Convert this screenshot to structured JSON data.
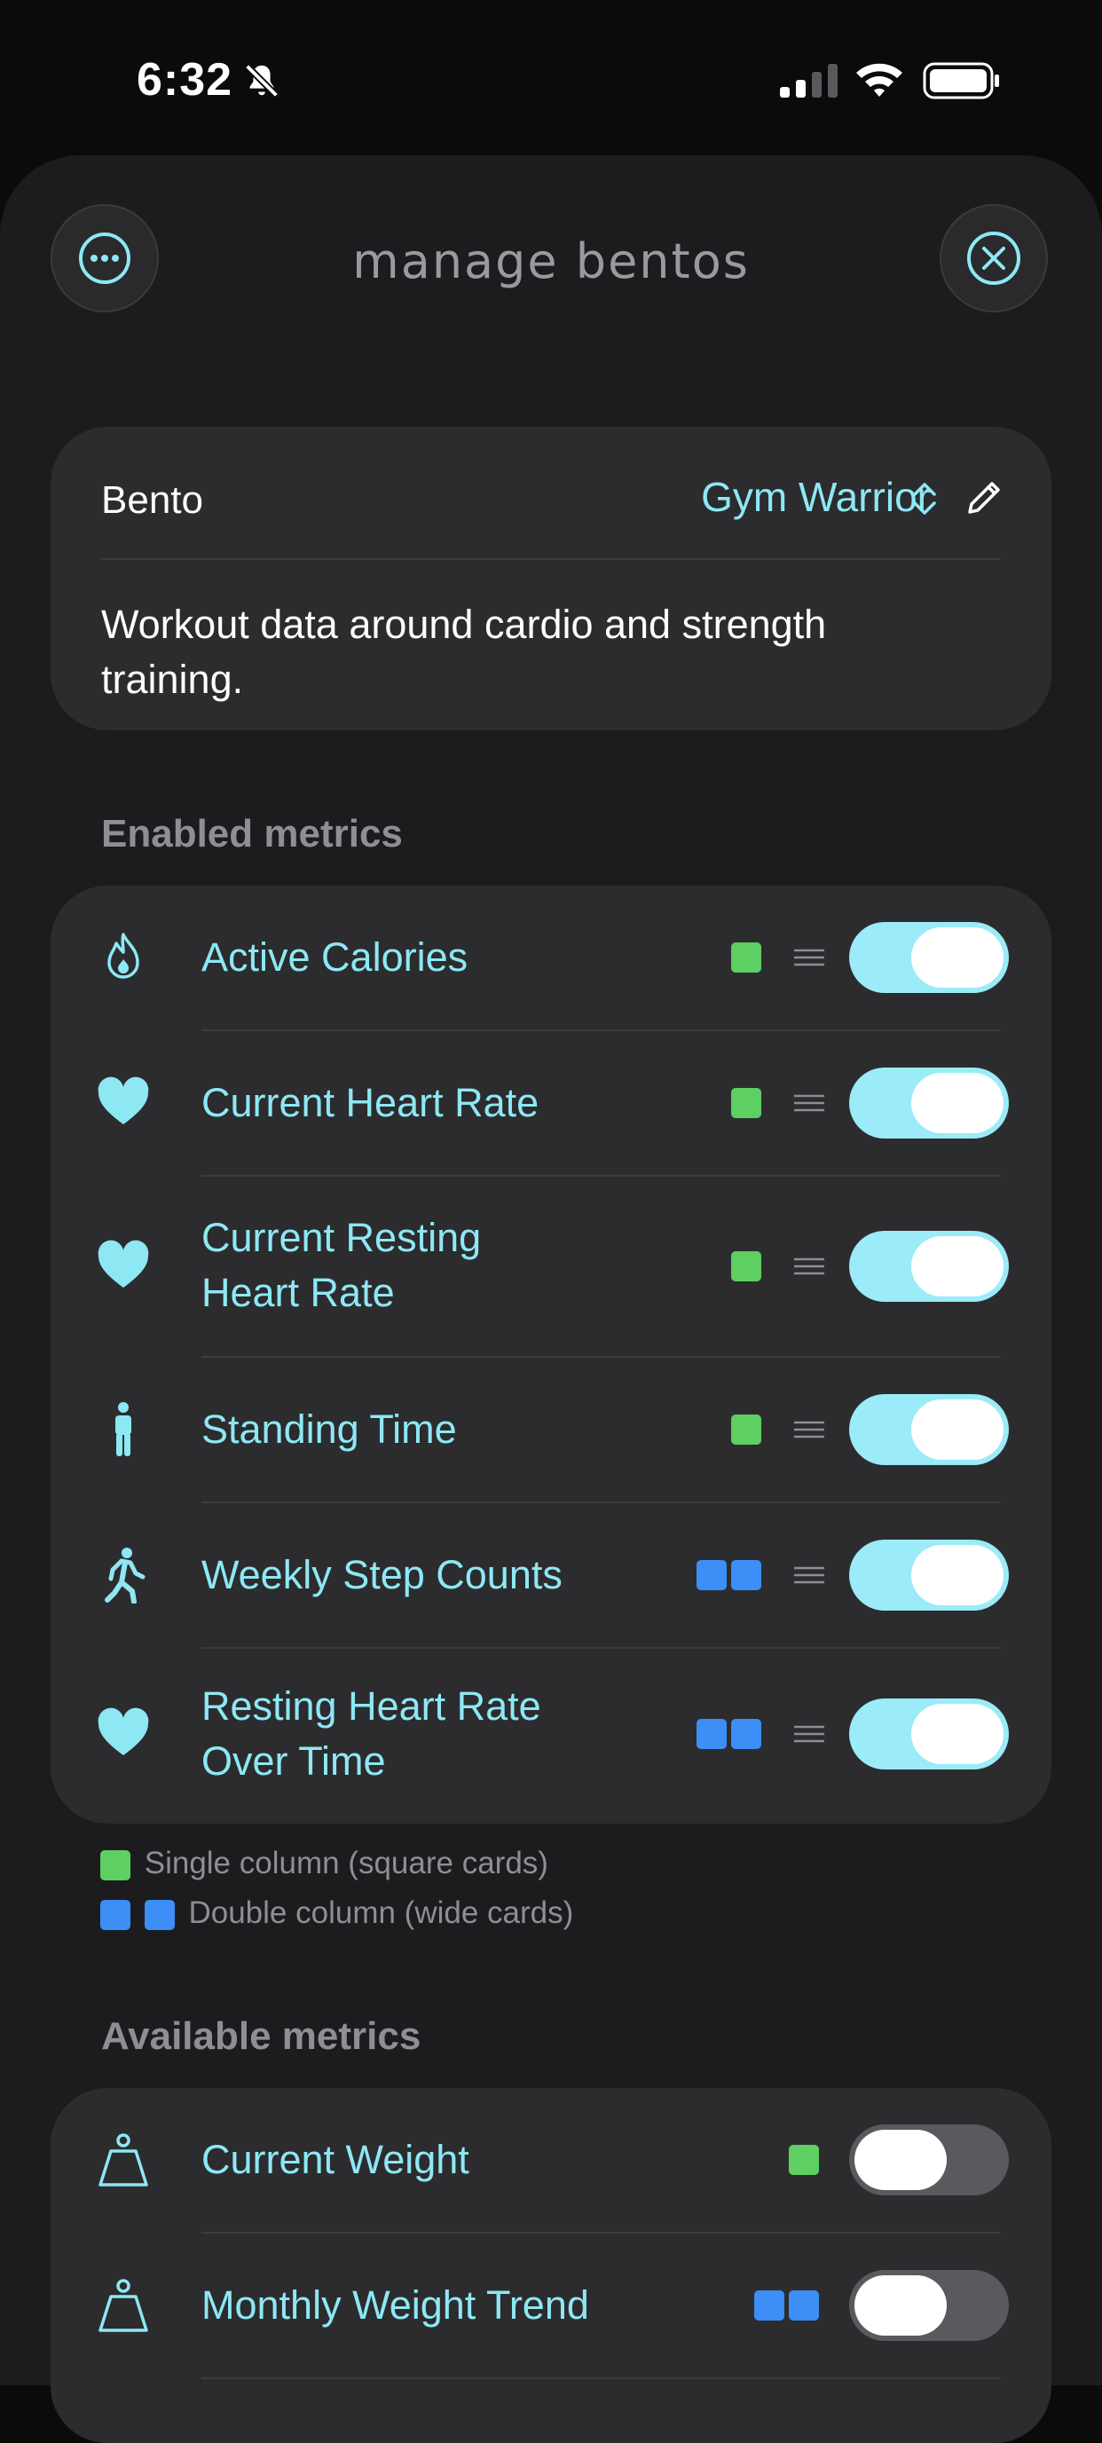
{
  "status": {
    "time": "6:32"
  },
  "sheet": {
    "title": "manage bentos"
  },
  "bento": {
    "label": "Bento",
    "value": "Gym Warrior",
    "description": "Workout data around cardio and strength training."
  },
  "enabled": {
    "header": "Enabled metrics",
    "items": [
      {
        "label": "Active Calories",
        "icon": "flame-icon",
        "size": "single",
        "enabled": true
      },
      {
        "label": "Current Heart Rate",
        "icon": "heart-icon",
        "size": "single",
        "enabled": true
      },
      {
        "label": "Current Resting Heart Rate",
        "icon": "heart-icon",
        "size": "single",
        "enabled": true
      },
      {
        "label": "Standing Time",
        "icon": "standing-person-icon",
        "size": "single",
        "enabled": true
      },
      {
        "label": "Weekly Step Counts",
        "icon": "walking-person-icon",
        "size": "double",
        "enabled": true
      },
      {
        "label": "Resting Heart Rate Over Time",
        "icon": "heart-icon",
        "size": "double",
        "enabled": true
      }
    ]
  },
  "legend": {
    "single": "Single column (square cards)",
    "double": "Double column (wide cards)"
  },
  "available": {
    "header": "Available metrics",
    "items": [
      {
        "label": "Current Weight",
        "icon": "scale-weight-icon",
        "size": "single",
        "enabled": false
      },
      {
        "label": "Monthly Weight Trend",
        "icon": "scale-weight-icon",
        "size": "double",
        "enabled": false
      }
    ]
  },
  "colors": {
    "accent": "#8de8f4",
    "single": "#5ecf63",
    "double": "#3d8ef7"
  }
}
